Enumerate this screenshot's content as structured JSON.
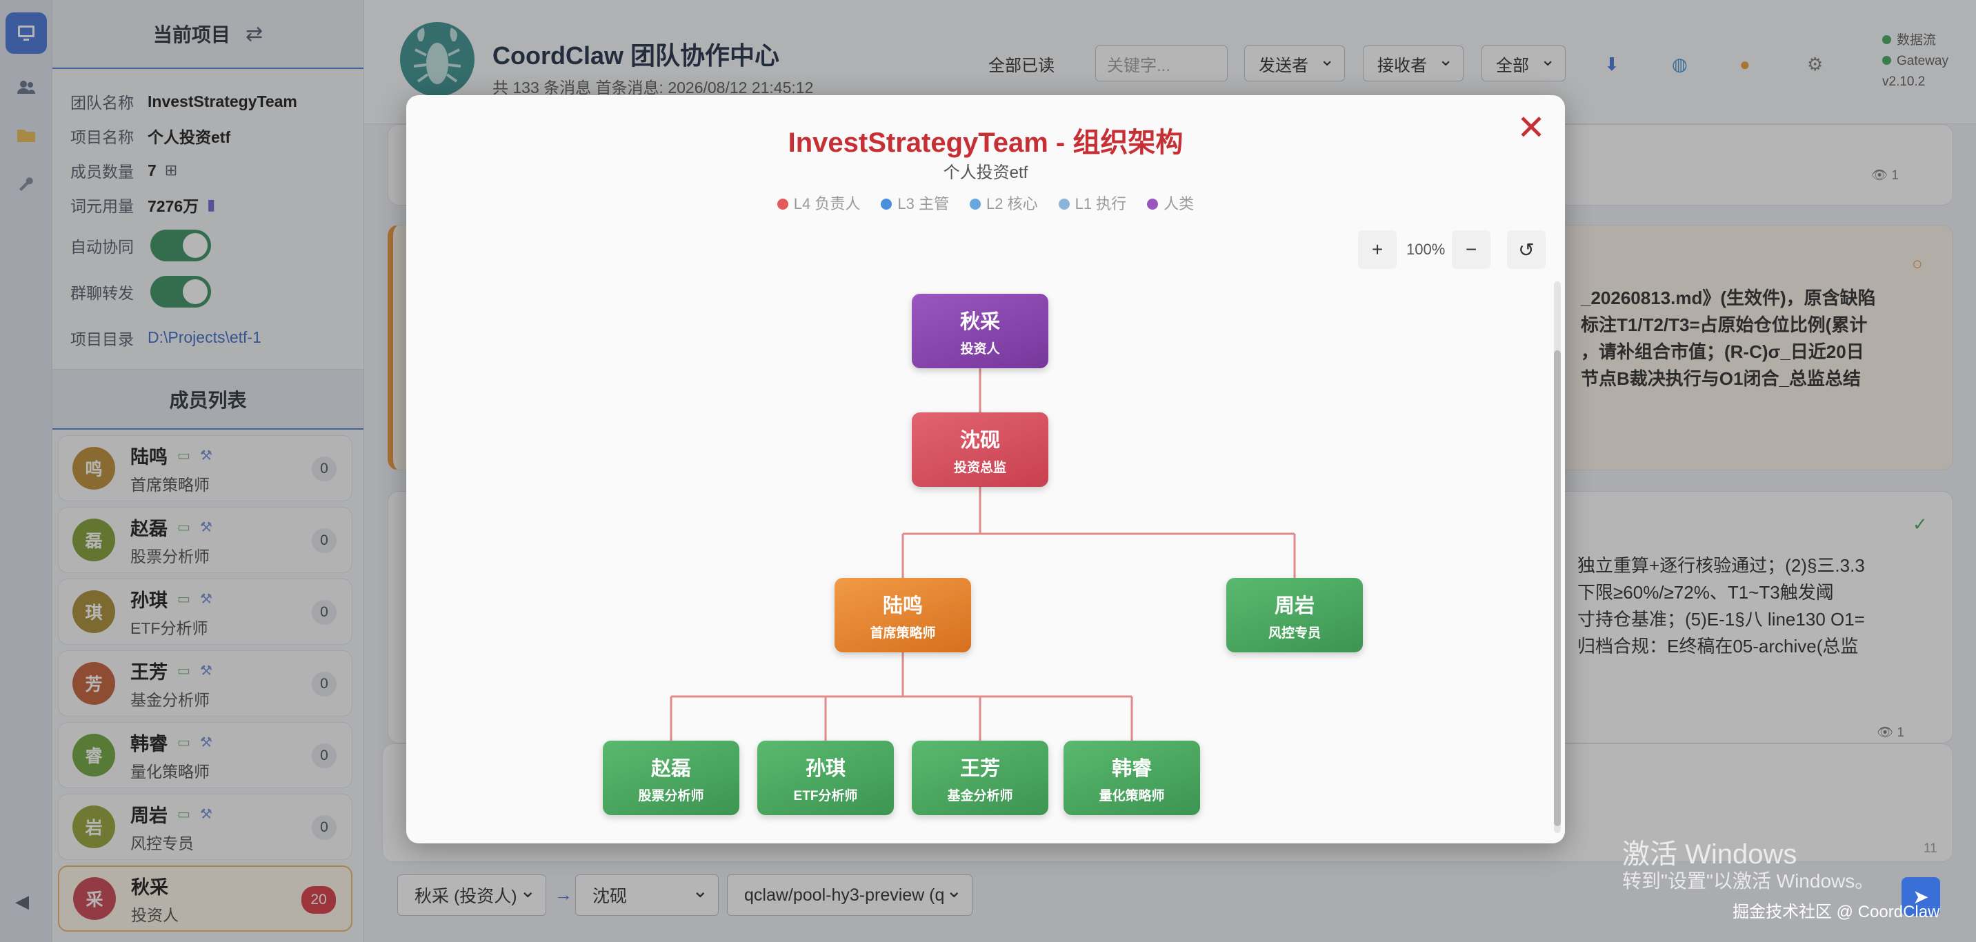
{
  "sidebar": {
    "header": "当前项目",
    "info": [
      {
        "label": "团队名称",
        "value": "InvestStrategyTeam"
      },
      {
        "label": "项目名称",
        "value": "个人投资etf"
      },
      {
        "label": "成员数量",
        "value": "7"
      },
      {
        "label": "词元用量",
        "value": "7276万"
      },
      {
        "label": "自动协同",
        "value": ""
      },
      {
        "label": "群聊转发",
        "value": ""
      },
      {
        "label": "项目目录",
        "value": "D:\\Projects\\etf-1"
      }
    ],
    "members_header": "成员列表",
    "members": [
      {
        "avatar": "鸣",
        "name": "陆鸣",
        "role": "首席策略师",
        "count": "0",
        "color": "#b8862a"
      },
      {
        "avatar": "磊",
        "name": "赵磊",
        "role": "股票分析师",
        "count": "0",
        "color": "#7a9a2a"
      },
      {
        "avatar": "琪",
        "name": "孙琪",
        "role": "ETF分析师",
        "count": "0",
        "color": "#a4862a"
      },
      {
        "avatar": "芳",
        "name": "王芳",
        "role": "基金分析师",
        "count": "0",
        "color": "#c0562e"
      },
      {
        "avatar": "睿",
        "name": "韩睿",
        "role": "量化策略师",
        "count": "0",
        "color": "#6aa034"
      },
      {
        "avatar": "岩",
        "name": "周岩",
        "role": "风控专员",
        "count": "0",
        "color": "#8e9e2c"
      },
      {
        "avatar": "采",
        "name": "秋采",
        "role": "投资人",
        "count": "20",
        "color": "#c93a4a"
      }
    ]
  },
  "header": {
    "title": "CoordClaw 团队协作中心",
    "sub": "共 133 条消息   首条消息: 2026/08/12 21:45:12",
    "mark_all_read": "全部已读",
    "search_placeholder": "关键字...",
    "sender": "发送者",
    "receiver": "接收者",
    "all": "全部",
    "status1": "数据流",
    "status2": "Gateway",
    "version": "v2.10.2"
  },
  "messages": {
    "orange_lines": [
      "_20260813.md》(生效件)，原含缺陷",
      "标注T1/T2/T3=占原始仓位比例(累计",
      "，请补组合市值；(R-C)σ_日近20日",
      "节点B裁决执行与O1闭合_总监总结"
    ],
    "white_lines": [
      "独立重算+逐行核验通过；(2)§三.3.3",
      "下限≥60%/≥72%、T1~T3触发阈",
      "寸持仓基准；(5)E-1§八 line130 O1=",
      "归档合规：E终稿在05-archive(总监"
    ],
    "eye1": "1",
    "eye2": "1",
    "char_count": "11"
  },
  "bottom": {
    "from": "秋采 (投资人)",
    "to": "沈砚",
    "model": "qclaw/pool-hy3-preview (q"
  },
  "modal": {
    "title": "InvestStrategyTeam - 组织架构",
    "subtitle": "个人投资etf",
    "legend": [
      {
        "label": "L4 负责人",
        "color": "#e45a5a"
      },
      {
        "label": "L3 主管",
        "color": "#4a8fdc"
      },
      {
        "label": "L2 核心",
        "color": "#6aa6e0"
      },
      {
        "label": "L1 执行",
        "color": "#8ab4d8"
      },
      {
        "label": "人类",
        "color": "#9a56bf"
      }
    ],
    "zoom_in": "+",
    "zoom_level": "100%",
    "zoom_out": "−",
    "reset": "↺",
    "close": "✕",
    "nodes": {
      "investor": {
        "name": "秋采",
        "role": "投资人"
      },
      "director": {
        "name": "沈砚",
        "role": "投资总监"
      },
      "chief": {
        "name": "陆鸣",
        "role": "首席策略师"
      },
      "risk": {
        "name": "周岩",
        "role": "风控专员"
      },
      "stock": {
        "name": "赵磊",
        "role": "股票分析师"
      },
      "etf": {
        "name": "孙琪",
        "role": "ETF分析师"
      },
      "fund": {
        "name": "王芳",
        "role": "基金分析师"
      },
      "quant": {
        "name": "韩睿",
        "role": "量化策略师"
      }
    }
  },
  "watermark": {
    "line1": "激活 Windows",
    "line2": "转到\"设置\"以激活 Windows。",
    "credit": "掘金技术社区 @ CoordClaw"
  }
}
